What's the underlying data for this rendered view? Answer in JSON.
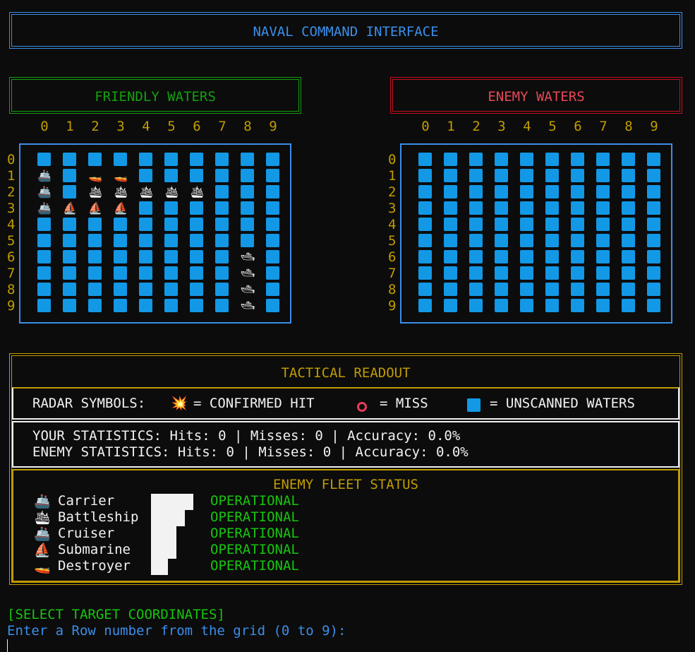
{
  "title": "NAVAL COMMAND INTERFACE",
  "friendly": {
    "label": "FRIENDLY WATERS",
    "col_headers": [
      "0",
      "1",
      "2",
      "3",
      "4",
      "5",
      "6",
      "7",
      "8",
      "9"
    ],
    "row_headers": [
      "0",
      "1",
      "2",
      "3",
      "4",
      "5",
      "6",
      "7",
      "8",
      "9"
    ],
    "grid": [
      [
        "~",
        "~",
        "~",
        "~",
        "~",
        "~",
        "~",
        "~",
        "~",
        "~"
      ],
      [
        "C",
        "~",
        "D",
        "D",
        "~",
        "~",
        "~",
        "~",
        "~",
        "~"
      ],
      [
        "C",
        "~",
        "B",
        "B",
        "B",
        "B",
        "B",
        "~",
        "~",
        "~"
      ],
      [
        "C",
        "S",
        "S",
        "S",
        "~",
        "~",
        "~",
        "~",
        "~",
        "~"
      ],
      [
        "~",
        "~",
        "~",
        "~",
        "~",
        "~",
        "~",
        "~",
        "~",
        "~"
      ],
      [
        "~",
        "~",
        "~",
        "~",
        "~",
        "~",
        "~",
        "~",
        "~",
        "~"
      ],
      [
        "~",
        "~",
        "~",
        "~",
        "~",
        "~",
        "~",
        "~",
        "K",
        "~"
      ],
      [
        "~",
        "~",
        "~",
        "~",
        "~",
        "~",
        "~",
        "~",
        "K",
        "~"
      ],
      [
        "~",
        "~",
        "~",
        "~",
        "~",
        "~",
        "~",
        "~",
        "K",
        "~"
      ],
      [
        "~",
        "~",
        "~",
        "~",
        "~",
        "~",
        "~",
        "~",
        "K",
        "~"
      ]
    ]
  },
  "enemy": {
    "label": "ENEMY WATERS",
    "col_headers": [
      "0",
      "1",
      "2",
      "3",
      "4",
      "5",
      "6",
      "7",
      "8",
      "9"
    ],
    "row_headers": [
      "0",
      "1",
      "2",
      "3",
      "4",
      "5",
      "6",
      "7",
      "8",
      "9"
    ],
    "grid": [
      [
        "~",
        "~",
        "~",
        "~",
        "~",
        "~",
        "~",
        "~",
        "~",
        "~"
      ],
      [
        "~",
        "~",
        "~",
        "~",
        "~",
        "~",
        "~",
        "~",
        "~",
        "~"
      ],
      [
        "~",
        "~",
        "~",
        "~",
        "~",
        "~",
        "~",
        "~",
        "~",
        "~"
      ],
      [
        "~",
        "~",
        "~",
        "~",
        "~",
        "~",
        "~",
        "~",
        "~",
        "~"
      ],
      [
        "~",
        "~",
        "~",
        "~",
        "~",
        "~",
        "~",
        "~",
        "~",
        "~"
      ],
      [
        "~",
        "~",
        "~",
        "~",
        "~",
        "~",
        "~",
        "~",
        "~",
        "~"
      ],
      [
        "~",
        "~",
        "~",
        "~",
        "~",
        "~",
        "~",
        "~",
        "~",
        "~"
      ],
      [
        "~",
        "~",
        "~",
        "~",
        "~",
        "~",
        "~",
        "~",
        "~",
        "~"
      ],
      [
        "~",
        "~",
        "~",
        "~",
        "~",
        "~",
        "~",
        "~",
        "~",
        "~"
      ],
      [
        "~",
        "~",
        "~",
        "~",
        "~",
        "~",
        "~",
        "~",
        "~",
        "~"
      ]
    ]
  },
  "ship_glyphs": {
    "C": "🚢",
    "D": "🚤",
    "B": "🛳",
    "S": "⛵",
    "K": "🛥"
  },
  "tactical": {
    "title": "TACTICAL READOUT",
    "radar_label": "RADAR SYMBOLS:",
    "hit_icon": "💥",
    "hit_text": "= CONFIRMED HIT",
    "miss_text": "= MISS",
    "unscanned_text": "= UNSCANNED WATERS",
    "your_stats": "YOUR STATISTICS: Hits: 0 | Misses: 0 | Accuracy: 0.0%",
    "enemy_stats": "ENEMY STATISTICS: Hits: 0 | Misses: 0 | Accuracy: 0.0%"
  },
  "fleet": {
    "title": "ENEMY FLEET STATUS",
    "ships": [
      {
        "icon": "🚢",
        "name": "Carrier",
        "status": "OPERATIONAL",
        "health": 5
      },
      {
        "icon": "🛳",
        "name": "Battleship",
        "status": "OPERATIONAL",
        "health": 4
      },
      {
        "icon": "🚢",
        "name": "Cruiser",
        "status": "OPERATIONAL",
        "health": 3
      },
      {
        "icon": "⛵",
        "name": "Submarine",
        "status": "OPERATIONAL",
        "health": 3
      },
      {
        "icon": "🚤",
        "name": "Destroyer",
        "status": "OPERATIONAL",
        "health": 2
      }
    ]
  },
  "prompt": {
    "select": "[SELECT TARGET COORDINATES]",
    "instruction": "Enter a Row number from the grid (0 to 9):"
  },
  "colors": {
    "accent_blue": "#3b8eea",
    "green": "#13a10e",
    "red": "#c50f1f",
    "gold": "#c19c00",
    "water": "#1398e6"
  }
}
